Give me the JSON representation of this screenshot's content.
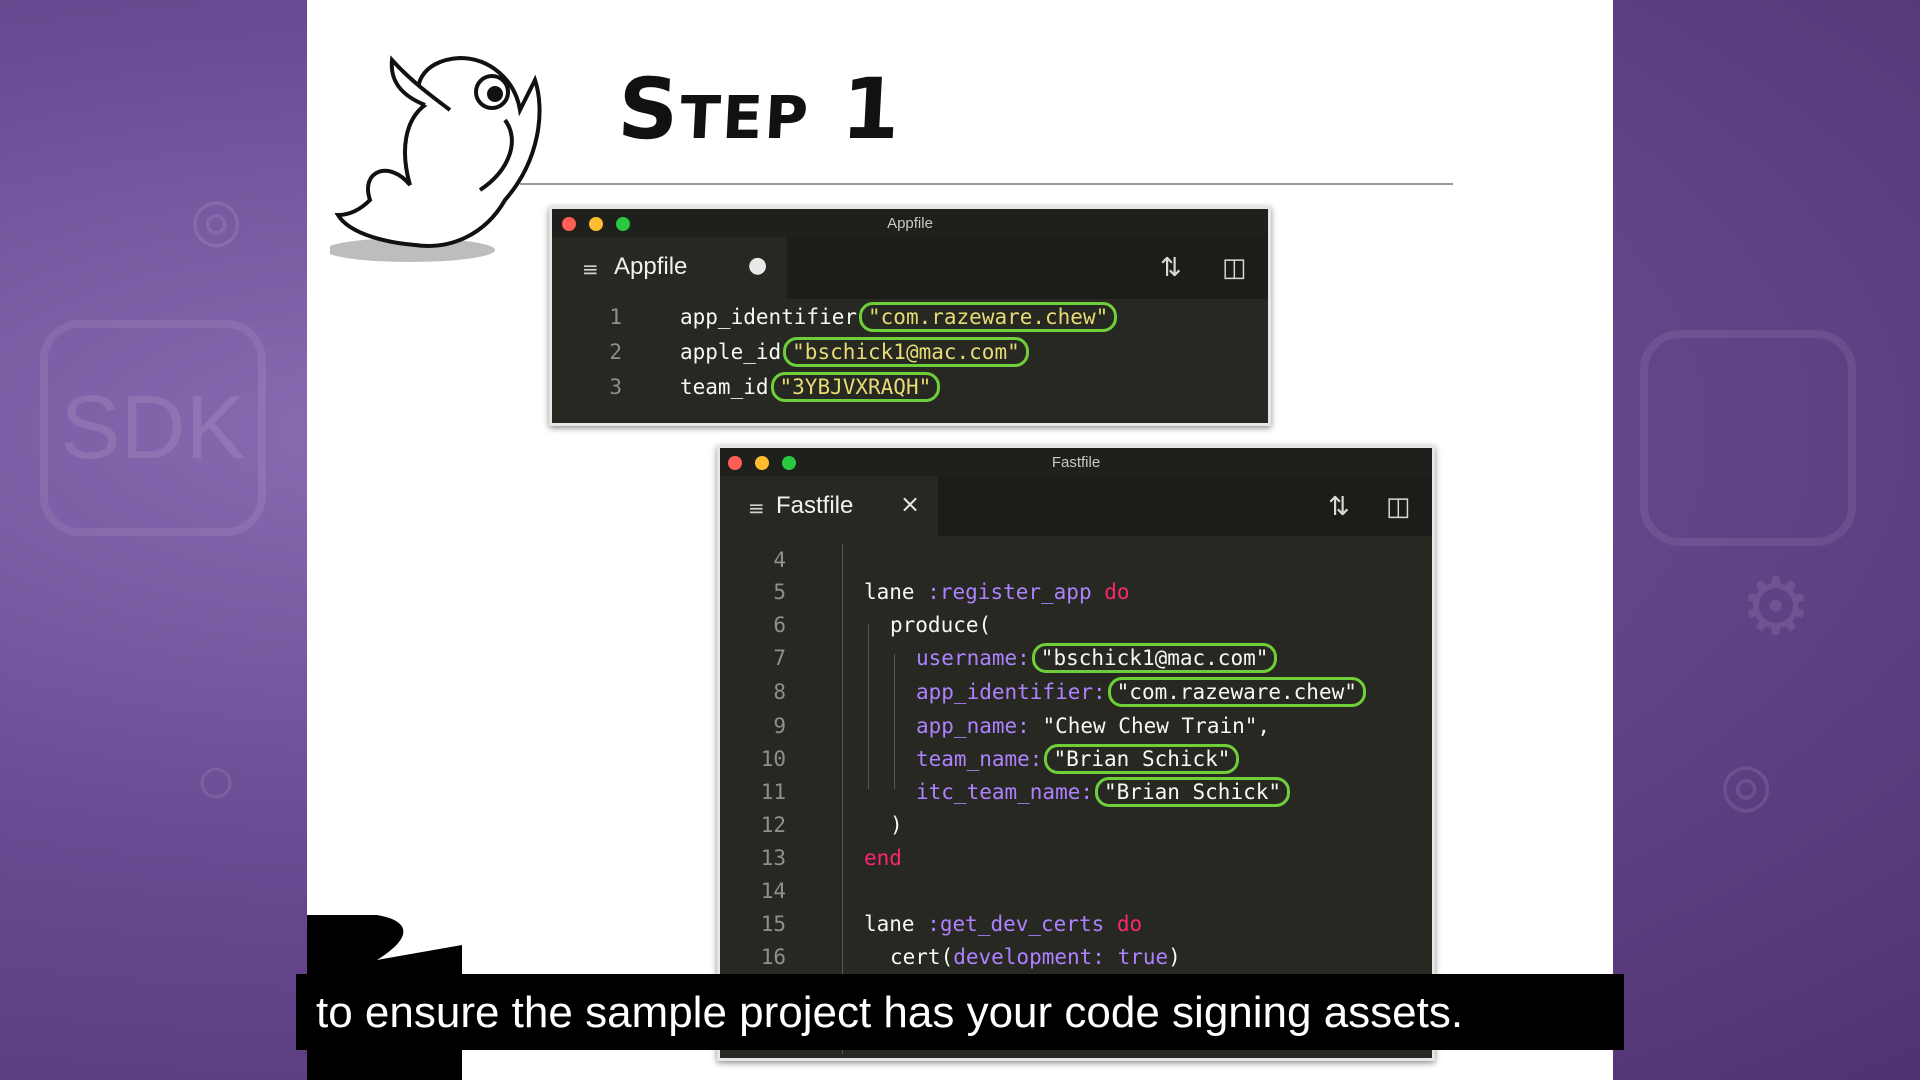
{
  "slide": {
    "title": "Step 1"
  },
  "appfile_window": {
    "title": "Appfile",
    "tab_label": "Appfile",
    "tab_modified_icon": "dot-icon",
    "lines": [
      {
        "num": "1",
        "key": "app_identifier",
        "value": "\"com.razeware.chew\""
      },
      {
        "num": "2",
        "key": "apple_id",
        "value": "\"bschick1@mac.com\""
      },
      {
        "num": "3",
        "key": "team_id",
        "value": "\"3YBJVXRAQH\""
      }
    ]
  },
  "fastfile_window": {
    "title": "Fastfile",
    "tab_label": "Fastfile",
    "tab_close": "×",
    "line_numbers": [
      "4",
      "5",
      "6",
      "7",
      "8",
      "9",
      "10",
      "11",
      "12",
      "13",
      "14",
      "15",
      "16"
    ],
    "l5": {
      "kw": "lane",
      "sym": ":register_app",
      "do": "do"
    },
    "l6": {
      "text": "produce("
    },
    "l7": {
      "key": "username:",
      "value": "\"bschick1@mac.com\""
    },
    "l8": {
      "key": "app_identifier:",
      "value": "\"com.razeware.chew\""
    },
    "l9": {
      "key": "app_name:",
      "value": "\"Chew Chew Train\","
    },
    "l10": {
      "key": "team_name:",
      "value": "\"Brian Schick\""
    },
    "l11": {
      "key": "itc_team_name:",
      "value": "\"Brian Schick\""
    },
    "l12": {
      "text": ")"
    },
    "l13": {
      "text": "end"
    },
    "l15": {
      "kw": "lane",
      "sym": ":get_dev_certs",
      "do": "do"
    },
    "l16": {
      "call": "cert(",
      "key": "development:",
      "value": "true",
      "close": ")"
    }
  },
  "toolbar_icons": [
    "git-compare-icon",
    "split-pane-icon"
  ],
  "caption": {
    "text": "to ensure the sample project has your code signing assets."
  },
  "colors": {
    "accent_highlight": "#6fcf3a",
    "editor_bg": "#272822",
    "background": "#6c4c90"
  }
}
